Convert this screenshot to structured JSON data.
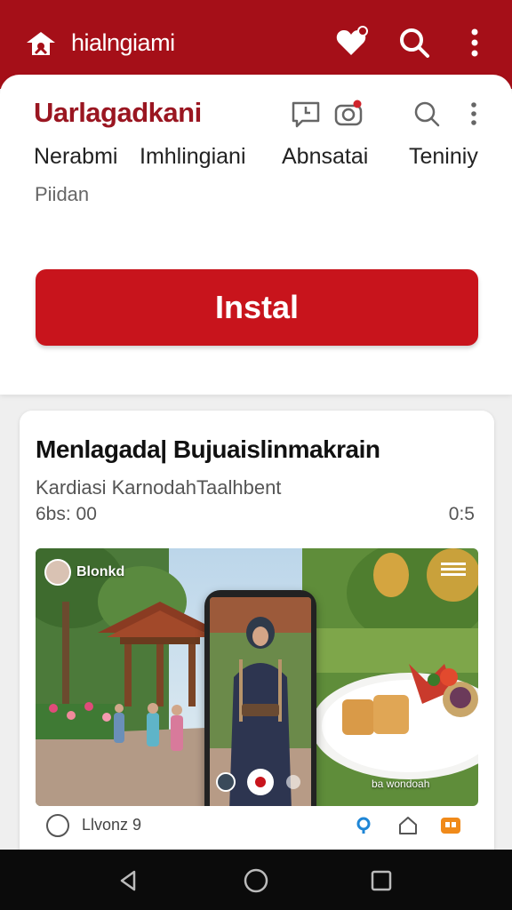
{
  "appbar": {
    "app_name": "hialngiami"
  },
  "sheet": {
    "title": "Uarlagadkani",
    "tabs": [
      "Nerabmi",
      "Imhlingiani",
      "Abnsatai",
      "Teniniy"
    ],
    "subtab": "Piidan",
    "install_label": "Instal"
  },
  "card": {
    "title": "Menlagada| Bujuaislinmakrain",
    "subtitle": "Kardiasi KarnodahTaalhbent",
    "meta": "6bs: 00",
    "time": "0:5",
    "media_badge": "Blonkd",
    "overlay_caption": "ba wondoah",
    "action_label": "Llvonz 9"
  },
  "colors": {
    "brand": "#a50f18",
    "button": "#c8141c"
  }
}
